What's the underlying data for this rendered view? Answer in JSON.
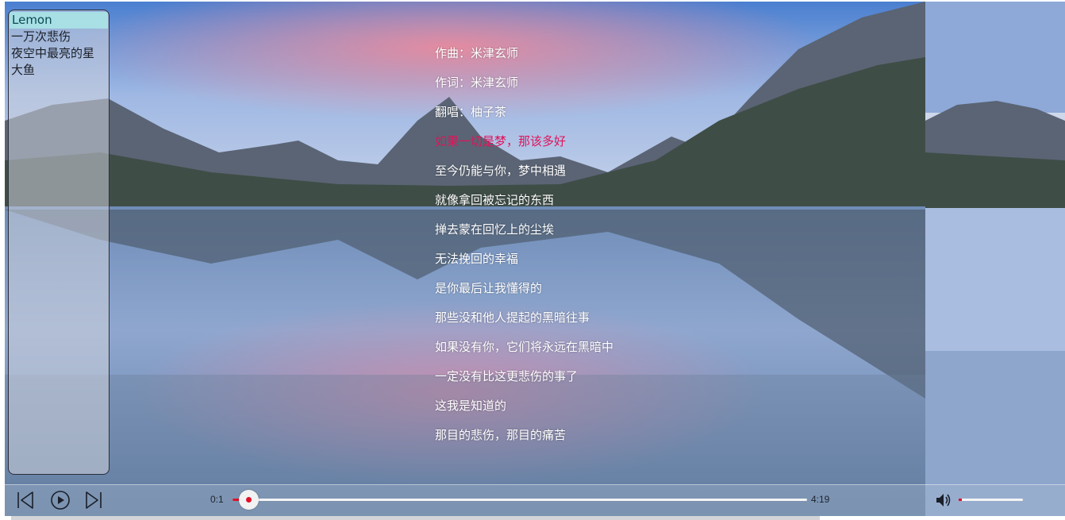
{
  "playlist": {
    "items": [
      {
        "label": "Lemon",
        "active": true
      },
      {
        "label": "一万次悲伤",
        "active": false
      },
      {
        "label": "夜空中最亮的星",
        "active": false
      },
      {
        "label": "大鱼",
        "active": false
      }
    ]
  },
  "lyrics": {
    "lines": [
      "作曲：米津玄师",
      "作词：米津玄师",
      "翻唱：柚子茶",
      "如果一切是梦，那该多好",
      "至今仍能与你，梦中相遇",
      "就像拿回被忘记的东西",
      "掸去蒙在回忆上的尘埃",
      "无法挽回的幸福",
      "是你最后让我懂得的",
      "那些没和他人提起的黑暗往事",
      "如果没有你，它们将永远在黑暗中",
      "一定没有比这更悲伤的事了",
      "这我是知道的",
      "那目的悲伤，那目的痛苦"
    ],
    "current_index": 3
  },
  "player": {
    "current_time": "0:1",
    "total_time": "4:19",
    "progress": 0.027,
    "volume": 0.05,
    "icons": {
      "prev": "skip-previous-icon",
      "play": "play-icon",
      "next": "skip-next-icon",
      "volume": "volume-icon"
    }
  },
  "colors": {
    "accent": "#e0102a",
    "current_lyric": "#e0145a",
    "active_item_bg": "#aae8e6"
  }
}
